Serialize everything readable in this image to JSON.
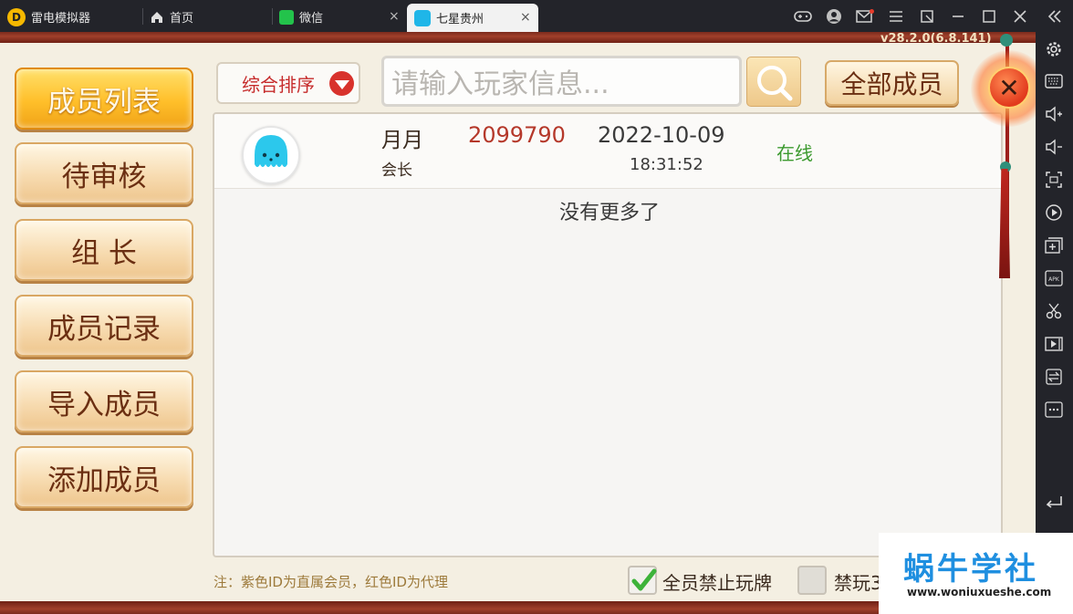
{
  "window": {
    "tabs": [
      {
        "label": "雷电模拟器"
      },
      {
        "label": "首页"
      },
      {
        "label": "微信"
      },
      {
        "label": "七星贵州"
      }
    ],
    "close_glyph": "×"
  },
  "game": {
    "version": "v28.2.0(6.8.141)",
    "menu": [
      {
        "label": "成员列表",
        "active": true
      },
      {
        "label": "待审核"
      },
      {
        "label": "组  长"
      },
      {
        "label": "成员记录"
      },
      {
        "label": "导入成员"
      },
      {
        "label": "添加成员"
      }
    ],
    "sort_label": "综合排序",
    "search_placeholder": "请输入玩家信息...",
    "all_members_label": "全部成员",
    "close_glyph": "✕",
    "members": [
      {
        "name": "月月",
        "role": "会长",
        "id": "2099790",
        "date": "2022-10-09",
        "time": "18:31:52",
        "status": "在线"
      }
    ],
    "no_more_text": "没有更多了",
    "note": "注：紫色ID为直属会员，红色ID为代理",
    "ban_all_label": "全员禁止玩牌",
    "ban_all_checked": true,
    "ban_play_label": "禁玩3",
    "ban_play_checked": false,
    "accent_colors": {
      "id_red": "#b5382a",
      "online_green": "#3c9a2f",
      "sort_red": "#c62b2b"
    }
  },
  "watermark": {
    "title": "蜗牛学社",
    "url": "www.woniuxueshe.com"
  }
}
